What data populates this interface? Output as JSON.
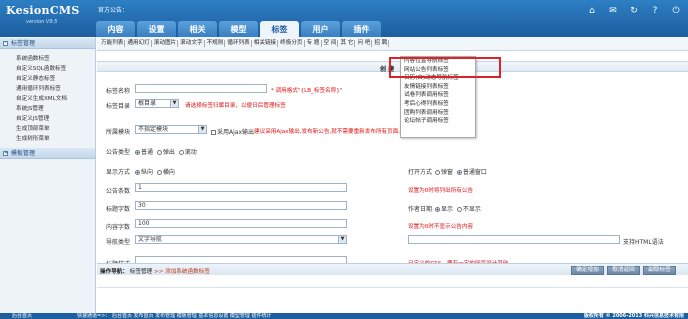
{
  "app": {
    "logo": "KesionCMS",
    "version": "version V9.5",
    "notice": "官方公告："
  },
  "nav_tabs": [
    "内容",
    "设置",
    "相关",
    "模型",
    "标签",
    "用户",
    "插件"
  ],
  "active_tab": 4,
  "top_icons": [
    "home-icon",
    "chat-icon",
    "refresh-icon",
    "help-icon",
    "logout-icon"
  ],
  "sidebar": {
    "section1": "标签管理",
    "items": [
      "系统函数标签",
      "自定义SQL函数标签",
      "自定义静态标签",
      "通用循环列表标签",
      "自定义生成XML文档",
      "系统JS管理",
      "自定义JS管理",
      "生成顶部菜单",
      "生成树形菜单"
    ],
    "section2": "模板管理"
  },
  "toolbar": [
    "万能列表",
    "通用幻灯",
    "滚动图片",
    "滚动文字",
    "不规则",
    "循环列表",
    "相关链接",
    "终极分页",
    "专 题",
    "空 间",
    "其 它",
    "问 吧",
    "招 聘"
  ],
  "dropdown": [
    "内容位置导航标签",
    "网站公告列表标签",
    "日历(自)动态导航标签",
    "友情链接列表标签",
    "试卷列表调用标签",
    "考后心得列表标签",
    "团购列表调用标签",
    "论坛帖子调用标签"
  ],
  "form": {
    "header": "创 建",
    "tag_name": {
      "label": "标签名称",
      "value": "",
      "hint": "* 调用格式\"{LB_标签名称}\""
    },
    "tag_dir": {
      "label": "标签目录",
      "value": "根目录",
      "hint": "请选择标签归属目录，以便日后管理标签"
    },
    "module": {
      "label": "所属模块",
      "value": "不指定模块",
      "ajax": "采用Ajax输出",
      "hint": "建议采用Ajax输出,发布新公告,就不需要重新发布所有页面。"
    },
    "notice_type": {
      "label": "公告类型",
      "options": [
        "普通",
        "弹出",
        "滚动"
      ],
      "selected": 0
    },
    "display": {
      "label": "显示方式",
      "options": [
        "纵向",
        "横向"
      ],
      "selected": 0
    },
    "open_mode": {
      "label": "打开方式",
      "options": [
        "弹窗",
        "普通窗口"
      ],
      "selected": 1
    },
    "count": {
      "label": "公告条数",
      "value": "1",
      "hint": "设置为0时将列出所有公告"
    },
    "title_len": {
      "label": "标题字数",
      "value": "30"
    },
    "author_date": {
      "label": "作者日期",
      "options": [
        "显示",
        "不显示"
      ],
      "selected": 0
    },
    "content_len": {
      "label": "内容字数",
      "value": "100",
      "hint": "设置为0时不显示公告内容"
    },
    "nav_type": {
      "label": "导航类型",
      "value": "文字导航",
      "html_label": "支持HTML语法"
    },
    "title_style": {
      "label": "标题样式",
      "hint": "已定义的CSS，要有一定的网页设计基础"
    }
  },
  "breadcrumb": {
    "prefix": "操作导航：",
    "item1": "标签管理",
    "sep": ">>",
    "item2": "添加系统函数标签"
  },
  "buttons": [
    "确定增加",
    "取消返回",
    "副取标签"
  ],
  "footer": {
    "left": "后台首页",
    "quick": "快速通道=>： 后台首页 发布首页 发布管理 模板管理 基本信息设置 模型管理 插件统计",
    "copyright": "版权所有 © 2006-2013 科兴信息技术有限"
  }
}
